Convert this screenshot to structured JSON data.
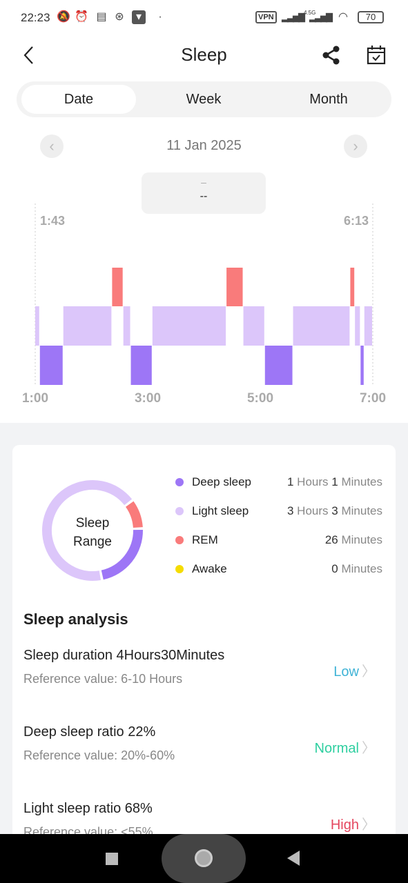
{
  "status_bar": {
    "time": "22:23",
    "vpn": "VPN",
    "network": "4.5G",
    "battery": "70",
    "icons": [
      "bell-off-icon",
      "alarm-icon",
      "message-icon",
      "run-icon",
      "shield-icon",
      "wifi-icon",
      "signal-icon"
    ]
  },
  "header": {
    "title": "Sleep",
    "back_icon": "chevron-left-icon",
    "share_icon": "share-icon",
    "calendar_icon": "calendar-check-icon"
  },
  "tabs": [
    {
      "label": "Date",
      "active": true
    },
    {
      "label": "Week",
      "active": false
    },
    {
      "label": "Month",
      "active": false
    }
  ],
  "date_nav": {
    "date": "11 Jan 2025"
  },
  "tooltip": {
    "line1": "–",
    "line2": "--"
  },
  "chart_data": {
    "type": "timeline",
    "start_label": "1:43",
    "end_label": "6:13",
    "x_ticks": [
      "1:00",
      "3:00",
      "5:00",
      "7:00"
    ],
    "x_range": [
      "1:00",
      "7:00"
    ],
    "levels": [
      "rem",
      "light",
      "deep"
    ],
    "colors": {
      "deep": "#9d76f6",
      "light": "#dcc6fa",
      "rem": "#f97b7b",
      "awake": "#f5dc00"
    },
    "segments": [
      {
        "stage": "light",
        "start": "1:00",
        "end": "1:05"
      },
      {
        "stage": "deep",
        "start": "1:05",
        "end": "1:30"
      },
      {
        "stage": "light",
        "start": "1:30",
        "end": "2:22"
      },
      {
        "stage": "rem",
        "start": "2:22",
        "end": "2:34"
      },
      {
        "stage": "light",
        "start": "2:34",
        "end": "2:42"
      },
      {
        "stage": "deep",
        "start": "2:42",
        "end": "3:05"
      },
      {
        "stage": "light",
        "start": "3:05",
        "end": "4:24"
      },
      {
        "stage": "rem",
        "start": "4:24",
        "end": "4:42"
      },
      {
        "stage": "light",
        "start": "4:42",
        "end": "5:05"
      },
      {
        "stage": "deep",
        "start": "5:05",
        "end": "5:35"
      },
      {
        "stage": "light",
        "start": "5:35",
        "end": "6:36"
      },
      {
        "stage": "rem",
        "start": "6:36",
        "end": "6:41"
      },
      {
        "stage": "light",
        "start": "6:41",
        "end": "6:47"
      },
      {
        "stage": "deep",
        "start": "6:47",
        "end": "6:51"
      },
      {
        "stage": "light",
        "start": "6:51",
        "end": "7:00"
      }
    ]
  },
  "summary": {
    "ring_label_1": "Sleep",
    "ring_label_2": "Range",
    "ring_minutes": {
      "deep": 61,
      "light": 183,
      "rem": 26,
      "awake": 0
    },
    "legend": [
      {
        "key": "deep",
        "label": "Deep sleep",
        "h": "1",
        "hu": "Hours",
        "m": "1",
        "mu": "Minutes"
      },
      {
        "key": "light",
        "label": "Light sleep",
        "h": "3",
        "hu": "Hours",
        "m": "3",
        "mu": "Minutes"
      },
      {
        "key": "rem",
        "label": "REM",
        "m": "26",
        "mu": "Minutes"
      },
      {
        "key": "awake",
        "label": "Awake",
        "m": "0",
        "mu": "Minutes"
      }
    ]
  },
  "analysis": {
    "title": "Sleep analysis",
    "rows": [
      {
        "label": "Sleep duration",
        "value": "4Hours30Minutes",
        "ref_label": "Reference value:",
        "ref": "6-10 Hours",
        "status": "Low",
        "color": "#3fb3d6"
      },
      {
        "label": "Deep sleep ratio",
        "value": "22%",
        "ref_label": "Reference value:",
        "ref": "20%-60%",
        "status": "Normal",
        "color": "#2ecfa0"
      },
      {
        "label": "Light sleep ratio",
        "value": "68%",
        "ref_label": "Reference value:",
        "ref": "<55%",
        "status": "High",
        "color": "#e4475f"
      }
    ]
  }
}
